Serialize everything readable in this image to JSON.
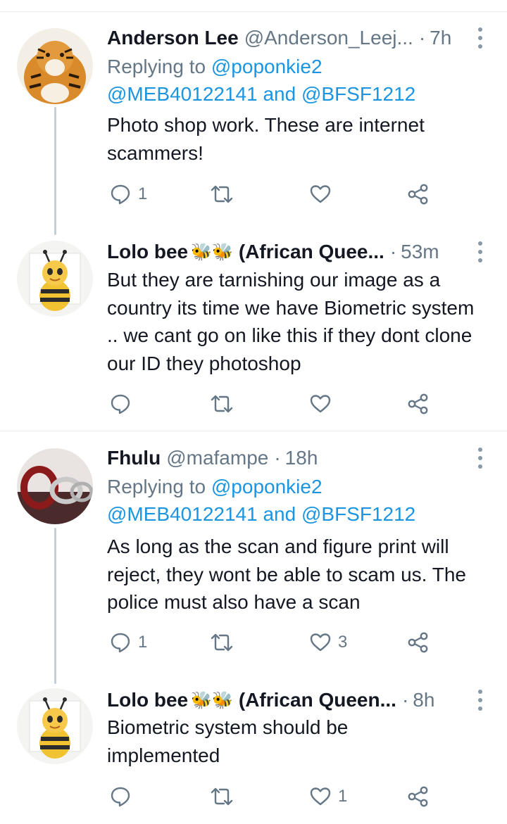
{
  "tweets": [
    {
      "name": "Anderson Lee",
      "handle": "@Anderson_Leej...",
      "time": "7h",
      "replying_label": "Replying to",
      "replying_to_1": "@poponkie2",
      "replying_to_2": "@MEB40122141",
      "replying_and": "and",
      "replying_to_3": "@BFSF1212",
      "text": "Photo shop work. These are internet scammers!",
      "replies": "1",
      "retweets": "",
      "likes": ""
    },
    {
      "name": "Lolo bee",
      "name_suffix": "(African Quee...",
      "emoji": "🐝🐝",
      "time": "53m",
      "text": "But they are tarnishing our image as a country its time we have Biometric system .. we cant go on like this if they dont clone our ID they photoshop",
      "replies": "",
      "retweets": "",
      "likes": ""
    },
    {
      "name": "Fhulu",
      "handle": "@mafampe",
      "time": "18h",
      "replying_label": "Replying to",
      "replying_to_1": "@poponkie2",
      "replying_to_2": "@MEB40122141",
      "replying_and": "and",
      "replying_to_3": "@BFSF1212",
      "text": "As long as the scan and figure print will reject, they wont be able to scam us. The police must also have a scan",
      "replies": "1",
      "retweets": "",
      "likes": "3"
    },
    {
      "name": "Lolo bee",
      "name_suffix": "(African Queen...",
      "emoji": "🐝🐝",
      "time": "8h",
      "text": "Biometric system should be implemented",
      "replies": "",
      "retweets": "",
      "likes": "1"
    }
  ],
  "icons": {
    "reply": "reply-icon",
    "retweet": "retweet-icon",
    "like": "heart-icon",
    "share": "share-icon",
    "more": "more-vertical-icon"
  },
  "colors": {
    "name": "#141823",
    "secondary": "#657786",
    "link": "#1b95e0",
    "icon": "#657786",
    "thread_line": "#c4cfd6",
    "separator": "#e6ecf0"
  }
}
